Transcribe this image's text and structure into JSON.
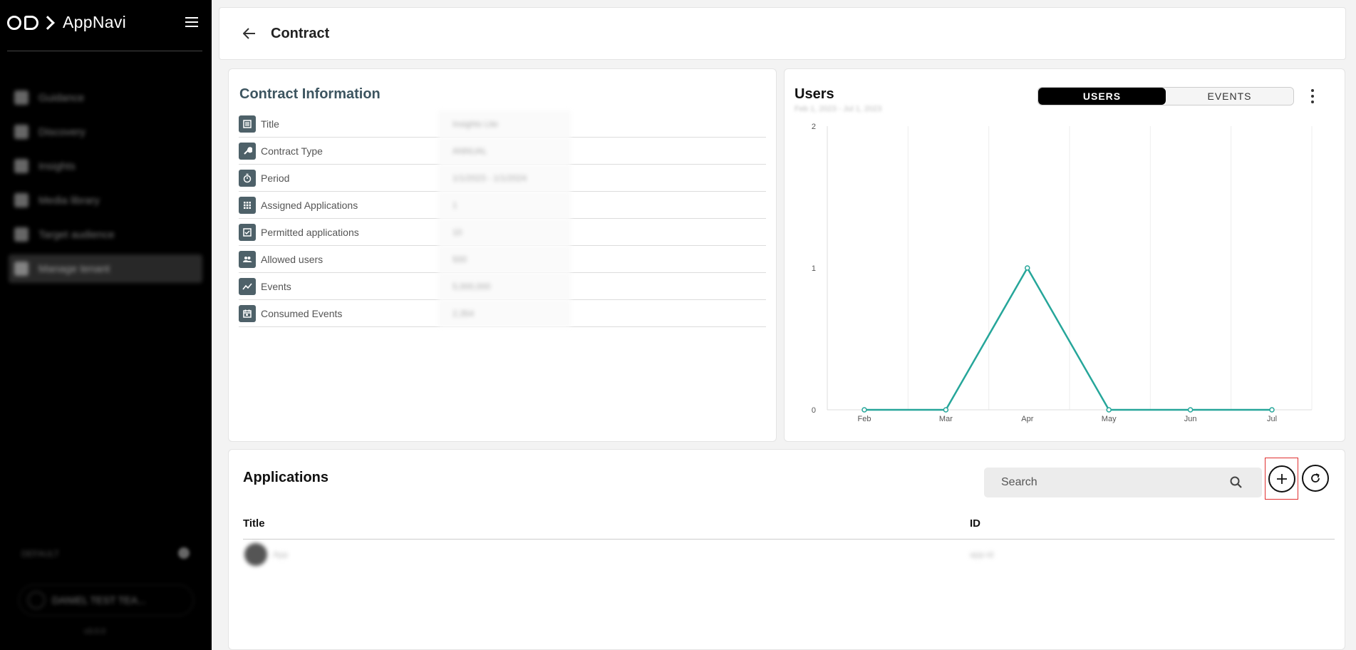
{
  "app": {
    "name": "AppNavi"
  },
  "sidebar": {
    "items": [
      {
        "label": "Guidance",
        "icon": "guidance-icon"
      },
      {
        "label": "Discovery",
        "icon": "discovery-icon"
      },
      {
        "label": "Insights",
        "icon": "insights-icon"
      },
      {
        "label": "Media library",
        "icon": "media-icon"
      },
      {
        "label": "Target audience",
        "icon": "target-icon"
      },
      {
        "label": "Manage tenant",
        "icon": "tenant-icon",
        "active": true
      }
    ],
    "footer_label": "DEFAULT",
    "workspace_name": "DANIEL TEST TEA...",
    "version": "v3.0.0"
  },
  "header": {
    "title": "Contract"
  },
  "contract_info": {
    "title": "Contract Information",
    "rows": [
      {
        "label": "Title",
        "value": "Insights Lite",
        "icon": "list-icon"
      },
      {
        "label": "Contract Type",
        "value": "ANNUAL",
        "icon": "wrench-icon"
      },
      {
        "label": "Period",
        "value": "1/1/2023 - 1/1/2024",
        "icon": "timer-icon"
      },
      {
        "label": "Assigned Applications",
        "value": "1",
        "icon": "grid-icon"
      },
      {
        "label": "Permitted applications",
        "value": "10",
        "icon": "checkbox-icon"
      },
      {
        "label": "Allowed users",
        "value": "500",
        "icon": "users-icon"
      },
      {
        "label": "Events",
        "value": "5,000,000",
        "icon": "trend-icon"
      },
      {
        "label": "Consumed Events",
        "value": "2,354",
        "icon": "calendar-icon"
      }
    ]
  },
  "users_chart": {
    "title": "Users",
    "subtitle": "Feb 1, 2023 - Jul 1, 2023",
    "toggle": {
      "active": "USERS",
      "inactive": "EVENTS"
    }
  },
  "chart_data": {
    "type": "line",
    "categories": [
      "Feb",
      "Mar",
      "Apr",
      "May",
      "Jun",
      "Jul"
    ],
    "series": [
      {
        "values": [
          0,
          0,
          1,
          0,
          0,
          0
        ]
      }
    ],
    "ylim": [
      0,
      2
    ],
    "yticks": [
      0,
      1,
      2
    ],
    "grid": true,
    "color": "#26a69a"
  },
  "applications": {
    "title": "Applications",
    "search_placeholder": "Search",
    "columns": {
      "title": "Title",
      "id": "ID"
    },
    "rows": [
      {
        "name": "App",
        "id": "app-id"
      }
    ]
  }
}
